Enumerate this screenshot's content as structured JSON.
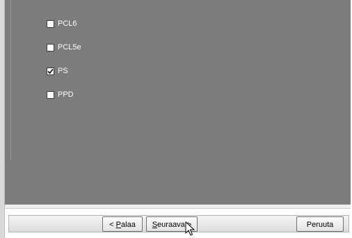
{
  "options": [
    {
      "label": "PCL6",
      "checked": false
    },
    {
      "label": "PCL5e",
      "checked": false
    },
    {
      "label": "PS",
      "checked": true
    },
    {
      "label": "PPD",
      "checked": false
    }
  ],
  "buttons": {
    "back_prefix": "< ",
    "back_hotkey": "P",
    "back_rest": "alaa",
    "next_hotkey": "S",
    "next_rest": "euraava >",
    "cancel": "Peruuta"
  },
  "colors": {
    "panel": "#7c7c7c",
    "label": "#ffffff"
  },
  "icons": {
    "check": "checkmark-icon",
    "cursor": "mouse-pointer-icon"
  }
}
